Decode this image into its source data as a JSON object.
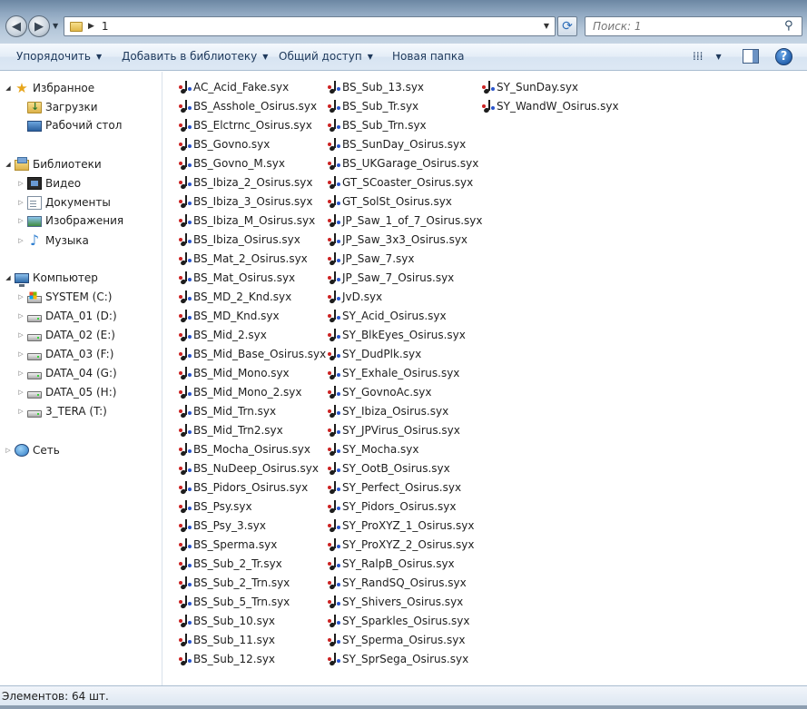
{
  "address": {
    "path": "1"
  },
  "search": {
    "placeholder": "Поиск: 1"
  },
  "toolbar": {
    "organize": "Упорядочить",
    "add_to_library": "Добавить в библиотеку",
    "share": "Общий доступ",
    "new_folder": "Новая папка"
  },
  "navigation": {
    "favorites": "Избранное",
    "downloads": "Загрузки",
    "desktop": "Рабочий стол",
    "libraries": "Библиотеки",
    "video": "Видео",
    "documents": "Документы",
    "images": "Изображения",
    "music": "Музыка",
    "computer": "Компьютер",
    "drives": [
      "SYSTEM (C:)",
      "DATA_01 (D:)",
      "DATA_02 (E:)",
      "DATA_03 (F:)",
      "DATA_04 (G:)",
      "DATA_05 (H:)",
      "3_TERA (T:)"
    ],
    "network": "Сеть"
  },
  "files": [
    "AC_Acid_Fake.syx",
    "BS_Asshole_Osirus.syx",
    "BS_Elctrnc_Osirus.syx",
    "BS_Govno.syx",
    "BS_Govno_M.syx",
    "BS_Ibiza_2_Osirus.syx",
    "BS_Ibiza_3_Osirus.syx",
    "BS_Ibiza_M_Osirus.syx",
    "BS_Ibiza_Osirus.syx",
    "BS_Mat_2_Osirus.syx",
    "BS_Mat_Osirus.syx",
    "BS_MD_2_Knd.syx",
    "BS_MD_Knd.syx",
    "BS_Mid_2.syx",
    "BS_Mid_Base_Osirus.syx",
    "BS_Mid_Mono.syx",
    "BS_Mid_Mono_2.syx",
    "BS_Mid_Trn.syx",
    "BS_Mid_Trn2.syx",
    "BS_Mocha_Osirus.syx",
    "BS_NuDeep_Osirus.syx",
    "BS_Pidors_Osirus.syx",
    "BS_Psy.syx",
    "BS_Psy_3.syx",
    "BS_Sperma.syx",
    "BS_Sub_2_Tr.syx",
    "BS_Sub_2_Trn.syx",
    "BS_Sub_5_Trn.syx",
    "BS_Sub_10.syx",
    "BS_Sub_11.syx",
    "BS_Sub_12.syx",
    "BS_Sub_13.syx",
    "BS_Sub_Tr.syx",
    "BS_Sub_Trn.syx",
    "BS_SunDay_Osirus.syx",
    "BS_UKGarage_Osirus.syx",
    "GT_SCoaster_Osirus.syx",
    "GT_SolSt_Osirus.syx",
    "JP_Saw_1_of_7_Osirus.syx",
    "JP_Saw_3x3_Osirus.syx",
    "JP_Saw_7.syx",
    "JP_Saw_7_Osirus.syx",
    "JvD.syx",
    "SY_Acid_Osirus.syx",
    "SY_BlkEyes_Osirus.syx",
    "SY_DudPlk.syx",
    "SY_Exhale_Osirus.syx",
    "SY_GovnoAc.syx",
    "SY_Ibiza_Osirus.syx",
    "SY_JPVirus_Osirus.syx",
    "SY_Mocha.syx",
    "SY_OotB_Osirus.syx",
    "SY_Perfect_Osirus.syx",
    "SY_Pidors_Osirus.syx",
    "SY_ProXYZ_1_Osirus.syx",
    "SY_ProXYZ_2_Osirus.syx",
    "SY_RalpB_Osirus.syx",
    "SY_RandSQ_Osirus.syx",
    "SY_Shivers_Osirus.syx",
    "SY_Sparkles_Osirus.syx",
    "SY_Sperma_Osirus.syx",
    "SY_SprSega_Osirus.syx",
    "SY_SunDay.syx",
    "SY_WandW_Osirus.syx"
  ],
  "status": {
    "items_count": "Элементов: 64 шт."
  }
}
